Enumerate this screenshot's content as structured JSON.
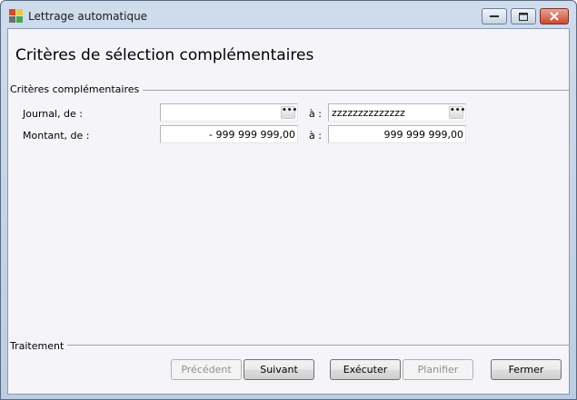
{
  "window": {
    "title": "Lettrage automatique"
  },
  "page": {
    "heading": "Critères de sélection complémentaires"
  },
  "criteria": {
    "group_label": "Critères complémentaires",
    "separator": "à :",
    "journal": {
      "label": "Journal, de :",
      "from_value": "",
      "to_value": "zzzzzzzzzzzzzz",
      "browse_label": "•••"
    },
    "amount": {
      "label": "Montant, de :",
      "from_value": "- 999 999 999,00",
      "to_value": "999 999 999,00"
    }
  },
  "treatment": {
    "group_label": "Traitement",
    "buttons": {
      "previous": "Précédent",
      "next": "Suivant",
      "execute": "Exécuter",
      "schedule": "Planifier",
      "close": "Fermer"
    }
  },
  "colors": {
    "titlebar": "#c4d3e6",
    "client_bg": "#f5f4f8",
    "close_button": "#c74a30"
  }
}
